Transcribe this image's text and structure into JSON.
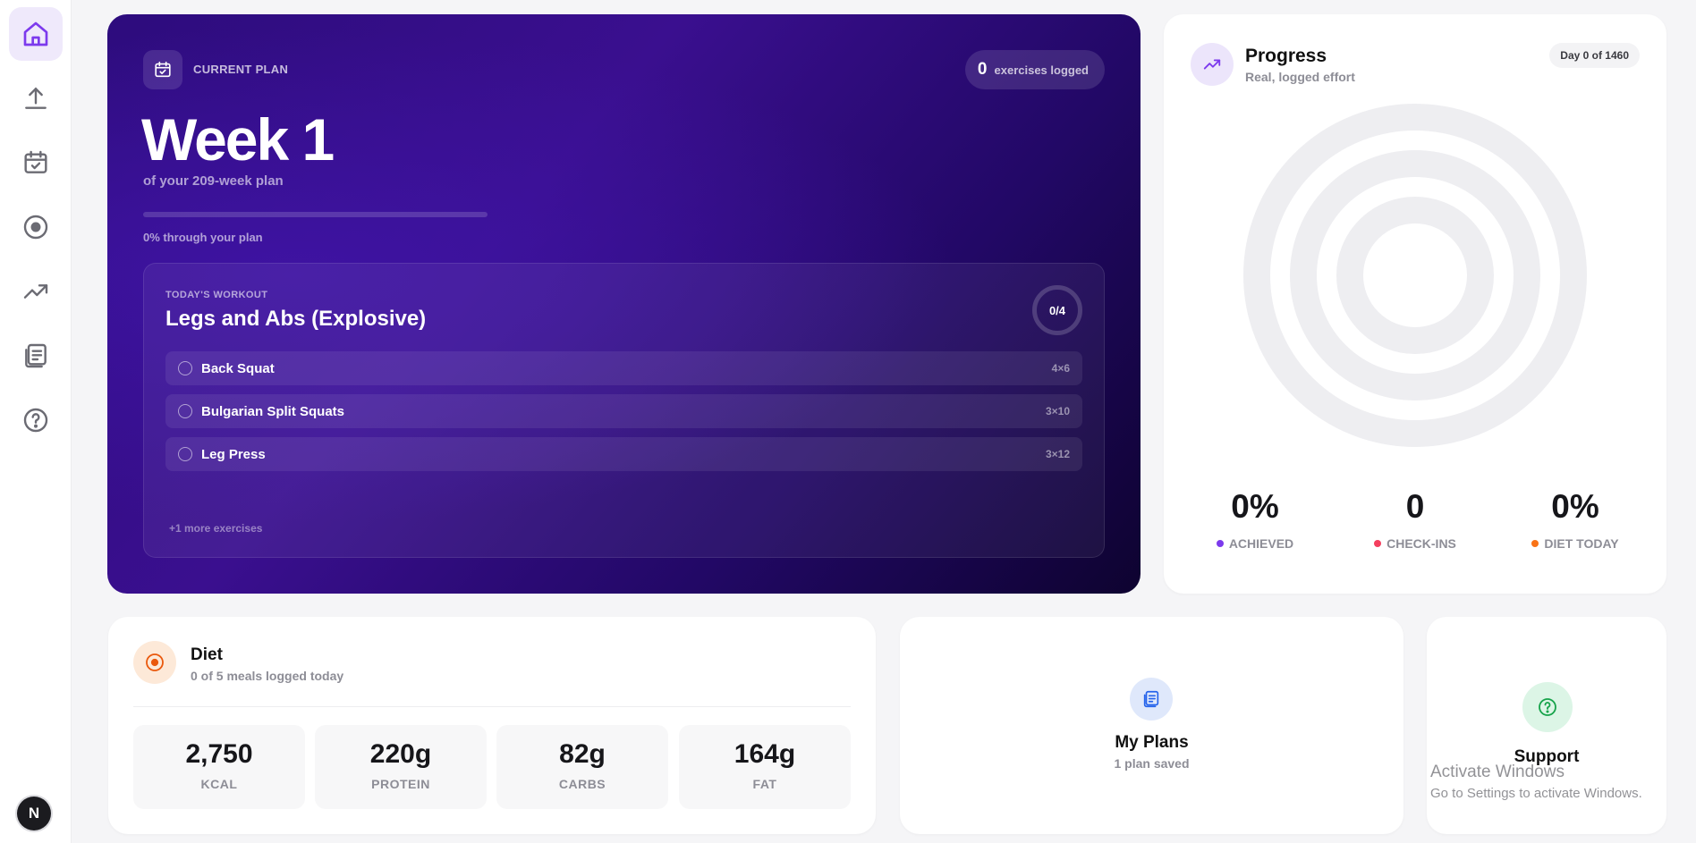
{
  "sidebar": {
    "items": [
      {
        "name": "home",
        "active": true
      },
      {
        "name": "upload"
      },
      {
        "name": "calendar"
      },
      {
        "name": "diet"
      },
      {
        "name": "progress"
      },
      {
        "name": "plans"
      },
      {
        "name": "help"
      }
    ],
    "avatar_letter": "N"
  },
  "hero": {
    "plan_label": "CURRENT PLAN",
    "logged_count": "0",
    "logged_text": "exercises logged",
    "week_title": "Week 1",
    "week_sub": "of your 209-week plan",
    "progress_fraction": 0,
    "progress_text": "0% through your plan",
    "workout": {
      "label": "TODAY'S WORKOUT",
      "title": "Legs and Abs (Explosive)",
      "ring_text": "0/4",
      "exercises": [
        {
          "name": "Back Squat",
          "sets": "4×6"
        },
        {
          "name": "Bulgarian Split Squats",
          "sets": "3×10"
        },
        {
          "name": "Leg Press",
          "sets": "3×12"
        }
      ],
      "more_text": "+1 more exercises"
    }
  },
  "progress": {
    "title": "Progress",
    "subtitle": "Real, logged effort",
    "day_pill": "Day 0 of 1460",
    "stats": [
      {
        "value": "0%",
        "label": "ACHIEVED",
        "color": "#7c3aed"
      },
      {
        "value": "0",
        "label": "CHECK-INS",
        "color": "#f43f5e"
      },
      {
        "value": "0%",
        "label": "DIET TODAY",
        "color": "#f97316"
      }
    ]
  },
  "diet": {
    "title": "Diet",
    "subtitle": "0 of 5 meals logged today",
    "macros": [
      {
        "value": "2,750",
        "label": "KCAL"
      },
      {
        "value": "220g",
        "label": "PROTEIN"
      },
      {
        "value": "82g",
        "label": "CARBS"
      },
      {
        "value": "164g",
        "label": "FAT"
      }
    ]
  },
  "plans": {
    "title": "My Plans",
    "subtitle": "1 plan saved"
  },
  "support": {
    "title": "Support"
  },
  "watermark": {
    "title": "Activate Windows",
    "subtitle": "Go to Settings to activate Windows."
  },
  "colors": {
    "accent": "#7c3aed",
    "hero_bg": "#3a0f8f"
  }
}
